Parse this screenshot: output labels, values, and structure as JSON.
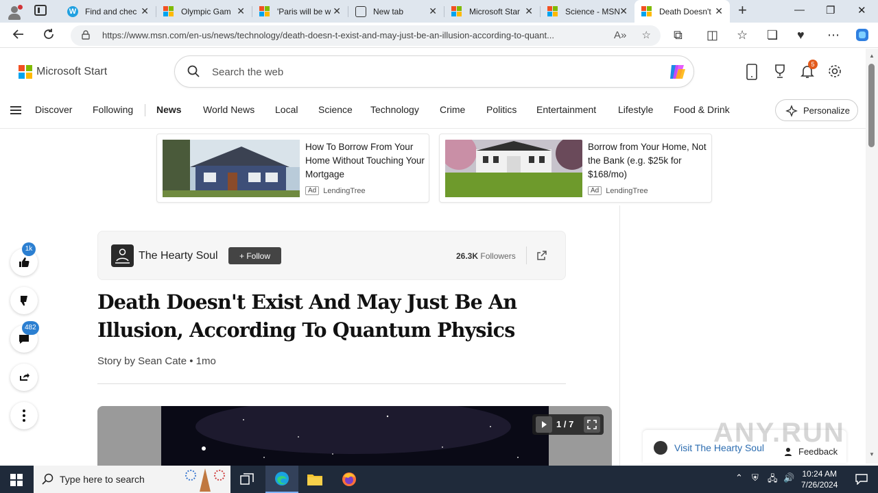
{
  "browser": {
    "tabs": [
      {
        "title": "Find and chec",
        "favicon": "w-icon"
      },
      {
        "title": "Olympic Gam",
        "favicon": "msn-icon"
      },
      {
        "title": "'Paris will be w",
        "favicon": "msn-icon"
      },
      {
        "title": "New tab",
        "favicon": "new-tab-icon"
      },
      {
        "title": "Microsoft Star",
        "favicon": "msn-icon"
      },
      {
        "title": "Science - MSN",
        "favicon": "msn-icon"
      },
      {
        "title": "Death Doesn't",
        "favicon": "msn-icon",
        "active": true
      }
    ],
    "url": "https://www.msn.com/en-us/news/technology/death-doesn-t-exist-and-may-just-be-an-illusion-according-to-quant..."
  },
  "header": {
    "brand": "Microsoft Start",
    "search_placeholder": "Search the web",
    "notification_count": "5"
  },
  "nav": {
    "items": [
      "Discover",
      "Following",
      "News",
      "World News",
      "Local",
      "Science",
      "Technology",
      "Crime",
      "Politics",
      "Entertainment",
      "Lifestyle",
      "Food & Drink"
    ],
    "active": "News",
    "personalize": "Personalize"
  },
  "ads": [
    {
      "title": "How To Borrow From Your Home Without Touching Your Mortgage",
      "tag": "Ad",
      "source": "LendingTree"
    },
    {
      "title": "Borrow from Your Home, Not the Bank (e.g. $25k for $168/mo)",
      "tag": "Ad",
      "source": "LendingTree"
    }
  ],
  "rail": {
    "like_count": "1k",
    "comment_count": "482"
  },
  "publisher": {
    "name": "The Hearty Soul",
    "follow_label": "+ Follow",
    "followers_count": "26.3K",
    "followers_label": "Followers"
  },
  "article": {
    "headline": "Death Doesn't Exist And May Just Be An Illusion, According To Quantum Physics",
    "byline": "Story by Sean Cate • 1mo",
    "gallery_counter": "1 / 7"
  },
  "footer": {
    "visit_label": "Visit The Hearty Soul",
    "feedback_label": "Feedback",
    "watermark": "ANY.RUN"
  },
  "taskbar": {
    "search_placeholder": "Type here to search",
    "time": "10:24 AM",
    "date": "7/26/2024"
  },
  "colors": {
    "accent_blue": "#2b7fd1",
    "taskbar": "#1f2a3a",
    "notification": "#e25a1c"
  }
}
